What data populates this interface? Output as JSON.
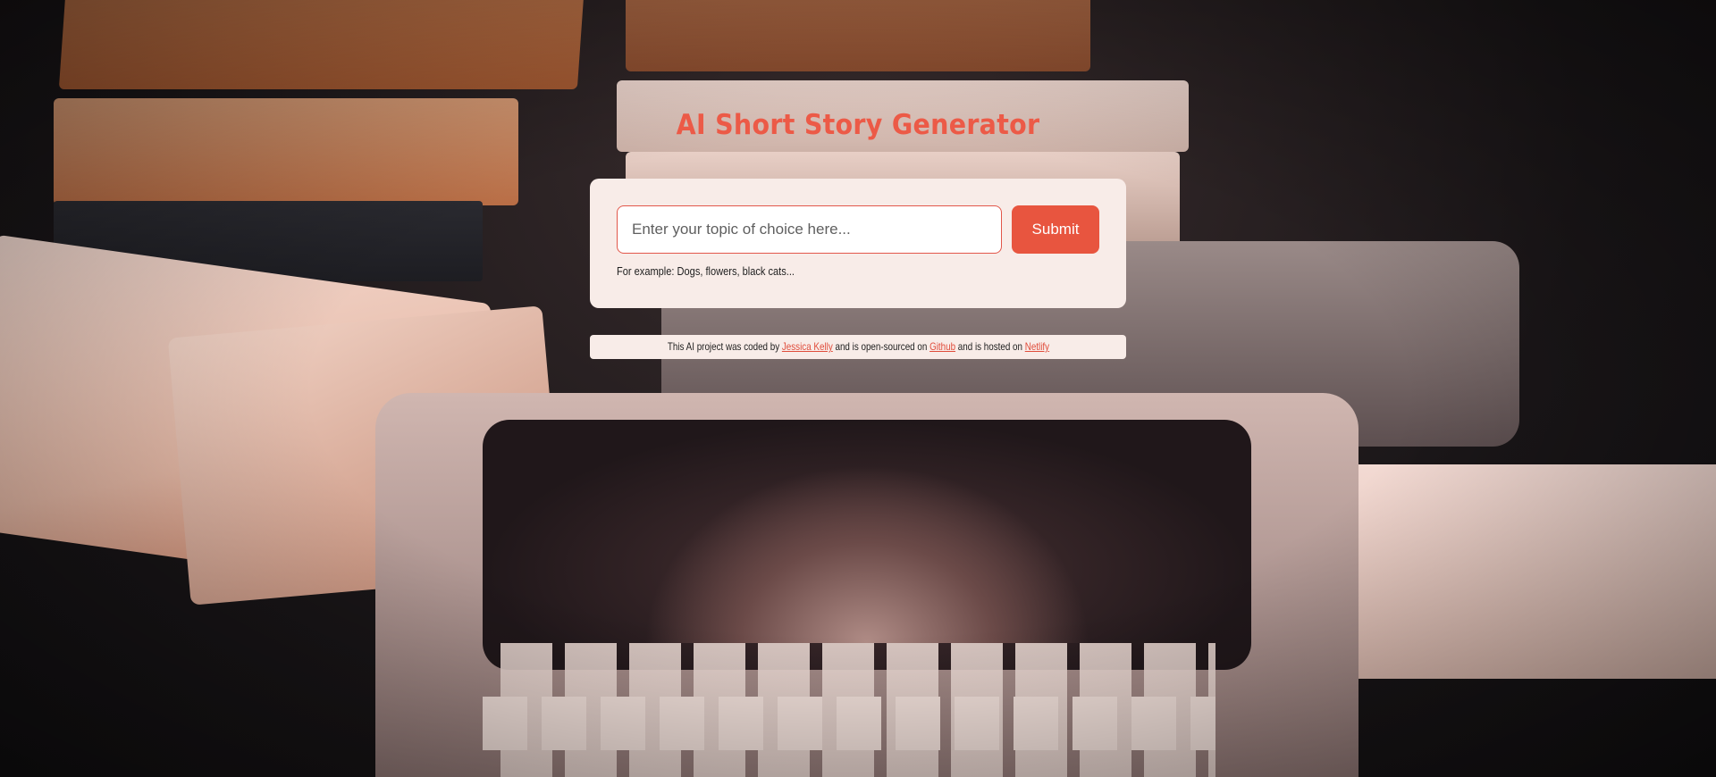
{
  "page": {
    "title": "AI Short Story Generator"
  },
  "form": {
    "input_placeholder": "Enter your topic of choice here...",
    "input_value": "",
    "submit_label": "Submit",
    "hint": "For example: Dogs, flowers, black cats..."
  },
  "footer": {
    "text_1": "This AI project was coded by ",
    "author_link": "Jessica Kelly",
    "text_2": " and is open-sourced on ",
    "github_link": "Github",
    "text_3": " and is hosted on ",
    "netlify_link": "Netlify"
  },
  "colors": {
    "accent": "#e8553f",
    "title": "#ec5a47",
    "card_bg": "#f8ece8"
  }
}
